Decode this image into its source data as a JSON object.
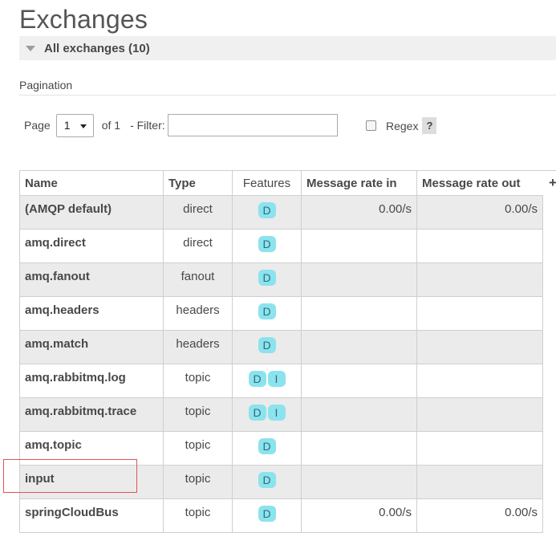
{
  "page": {
    "title": "Exchanges"
  },
  "section": {
    "title": "All exchanges (10)"
  },
  "pagination": {
    "heading": "Pagination",
    "page_label": "Page",
    "page_value": "1",
    "of_label": "of 1",
    "filter_label": "- Filter:",
    "filter_value": "",
    "regex_label": "Regex",
    "help_label": "?"
  },
  "table": {
    "headers": {
      "name": "Name",
      "type": "Type",
      "features": "Features",
      "rate_in": "Message rate in",
      "rate_out": "Message rate out",
      "add": "+"
    },
    "rows": [
      {
        "name": "(AMQP default)",
        "type": "direct",
        "features": [
          "D"
        ],
        "rate_in": "0.00/s",
        "rate_out": "0.00/s"
      },
      {
        "name": "amq.direct",
        "type": "direct",
        "features": [
          "D"
        ],
        "rate_in": "",
        "rate_out": ""
      },
      {
        "name": "amq.fanout",
        "type": "fanout",
        "features": [
          "D"
        ],
        "rate_in": "",
        "rate_out": ""
      },
      {
        "name": "amq.headers",
        "type": "headers",
        "features": [
          "D"
        ],
        "rate_in": "",
        "rate_out": ""
      },
      {
        "name": "amq.match",
        "type": "headers",
        "features": [
          "D"
        ],
        "rate_in": "",
        "rate_out": ""
      },
      {
        "name": "amq.rabbitmq.log",
        "type": "topic",
        "features": [
          "D",
          "I"
        ],
        "rate_in": "",
        "rate_out": ""
      },
      {
        "name": "amq.rabbitmq.trace",
        "type": "topic",
        "features": [
          "D",
          "I"
        ],
        "rate_in": "",
        "rate_out": ""
      },
      {
        "name": "amq.topic",
        "type": "topic",
        "features": [
          "D"
        ],
        "rate_in": "",
        "rate_out": ""
      },
      {
        "name": "input",
        "type": "topic",
        "features": [
          "D"
        ],
        "rate_in": "",
        "rate_out": ""
      },
      {
        "name": "springCloudBus",
        "type": "topic",
        "features": [
          "D"
        ],
        "rate_in": "0.00/s",
        "rate_out": "0.00/s"
      }
    ]
  },
  "colors": {
    "badge_bg": "#8ce3ee",
    "stripe_bg": "#ebebeb",
    "highlight_border": "#e05454"
  }
}
